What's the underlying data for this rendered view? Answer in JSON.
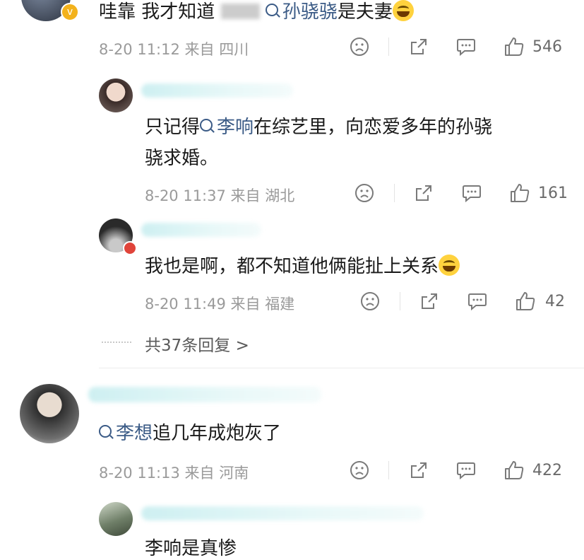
{
  "comments": [
    {
      "text_a": "哇靠 我才知道",
      "text_b": "是夫妻",
      "link": "孙骁骁",
      "date": "8-20 11:12",
      "source": "来自",
      "location": "四川",
      "likes": "546"
    },
    {
      "text_a": "只记得",
      "link": "李响",
      "text_b": "在综艺里，向恋爱多年的孙骁",
      "text_c": "骁求婚。",
      "date": "8-20 11:37",
      "source": "来自",
      "location": "湖北",
      "likes": "161"
    },
    {
      "text": "我也是啊，都不知道他俩能扯上关系",
      "date": "8-20 11:49",
      "source": "来自",
      "location": "福建",
      "likes": "42"
    },
    {
      "link": "李想",
      "text_b": "追几年成炮灰了",
      "date": "8-20 11:13",
      "source": "来自",
      "location": "河南",
      "likes": "422"
    },
    {
      "text": "李响是真惨"
    }
  ],
  "more_replies": "共37条回复 >",
  "colors": {
    "link": "#3b5b86",
    "meta": "#9a9a9a",
    "icon": "#7a7a7a"
  }
}
